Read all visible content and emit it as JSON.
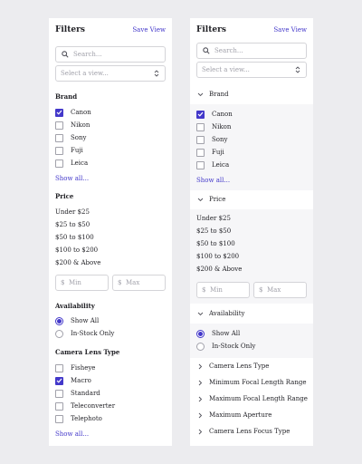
{
  "colors": {
    "accent": "#4338ca",
    "border": "#d4d4d8",
    "muted": "#a1a1aa"
  },
  "left": {
    "title": "Filters",
    "save_view": "Save View",
    "search_placeholder": "Search...",
    "select_placeholder": "Select a view...",
    "brand": {
      "heading": "Brand",
      "items": [
        {
          "label": "Canon",
          "checked": true
        },
        {
          "label": "Nikon",
          "checked": false
        },
        {
          "label": "Sony",
          "checked": false
        },
        {
          "label": "Fuji",
          "checked": false
        },
        {
          "label": "Leica",
          "checked": false
        }
      ],
      "show_all": "Show all..."
    },
    "price": {
      "heading": "Price",
      "ranges": [
        "Under $25",
        "$25 to $50",
        "$50 to $100",
        "$100 to $200",
        "$200 & Above"
      ],
      "currency": "$",
      "min_placeholder": "Min",
      "max_placeholder": "Max"
    },
    "availability": {
      "heading": "Availability",
      "options": [
        {
          "label": "Show All",
          "selected": true
        },
        {
          "label": "In-Stock Only",
          "selected": false
        }
      ]
    },
    "lens": {
      "heading": "Camera Lens Type",
      "items": [
        {
          "label": "Fisheye",
          "checked": false
        },
        {
          "label": "Macro",
          "checked": true
        },
        {
          "label": "Standard",
          "checked": false
        },
        {
          "label": "Teleconverter",
          "checked": false
        },
        {
          "label": "Telephoto",
          "checked": false
        }
      ],
      "show_all": "Show all..."
    }
  },
  "right": {
    "title": "Filters",
    "save_view": "Save View",
    "search_placeholder": "Search...",
    "select_placeholder": "Select a view...",
    "brand": {
      "heading": "Brand",
      "items": [
        {
          "label": "Canon",
          "checked": true
        },
        {
          "label": "Nikon",
          "checked": false
        },
        {
          "label": "Sony",
          "checked": false
        },
        {
          "label": "Fuji",
          "checked": false
        },
        {
          "label": "Leica",
          "checked": false
        }
      ],
      "show_all": "Show all..."
    },
    "price": {
      "heading": "Price",
      "ranges": [
        "Under $25",
        "$25 to $50",
        "$50 to $100",
        "$100 to $200",
        "$200 & Above"
      ],
      "currency": "$",
      "min_placeholder": "Min",
      "max_placeholder": "Max"
    },
    "availability": {
      "heading": "Availability",
      "options": [
        {
          "label": "Show All",
          "selected": true
        },
        {
          "label": "In-Stock Only",
          "selected": false
        }
      ]
    },
    "collapsed": [
      "Camera Lens Type",
      "Minimum Focal Length Range",
      "Maximum Focal Length Range",
      "Maximum Aperture",
      "Camera Lens Focus Type"
    ]
  }
}
